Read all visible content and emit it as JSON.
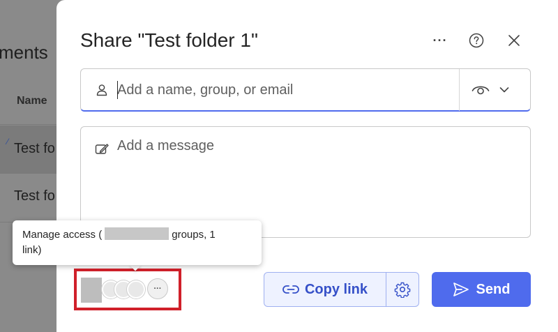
{
  "background": {
    "page_title": "ments",
    "column_header": "Name",
    "rows": [
      "Test fo",
      "Test fo"
    ]
  },
  "dialog": {
    "title": "Share \"Test folder 1\"",
    "header_buttons": {
      "more_label": "···",
      "help_icon": "question-circle-icon",
      "close_icon": "close-icon"
    },
    "to_field": {
      "placeholder": "Add a name, group, or email",
      "value": "",
      "icon": "person-icon",
      "permission_icon": "eye-icon"
    },
    "message_field": {
      "placeholder": "Add a message",
      "value": "",
      "icon": "edit-icon"
    },
    "copy_link_label": "Copy link",
    "send_label": "Send",
    "access_more_label": "···"
  },
  "tooltip": {
    "prefix": "Manage access (",
    "suffix": "groups, 1",
    "line2": "link)"
  },
  "colors": {
    "accent": "#4f6bed",
    "highlight_border": "#d0202a"
  }
}
